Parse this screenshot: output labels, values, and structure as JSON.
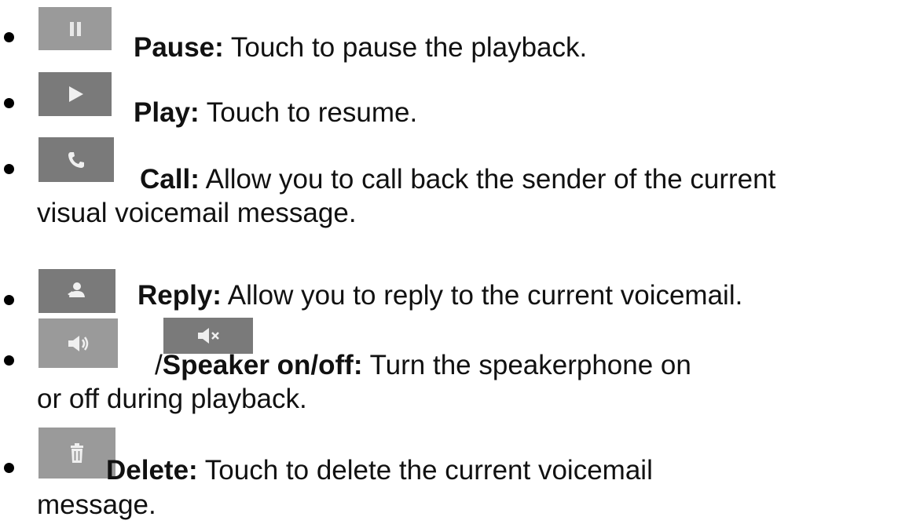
{
  "items": [
    {
      "icon": "pause-icon",
      "term": "Pause:",
      "text": " Touch to pause the playback.",
      "continuation": ""
    },
    {
      "icon": "play-icon",
      "term": "Play:",
      "text": " Touch to resume.",
      "continuation": ""
    },
    {
      "icon": "phone-icon",
      "term": "Call:",
      "text": " Allow you to call back the sender of the current",
      "continuation": "visual voicemail message."
    },
    {
      "icon": "reply-icon",
      "term": "Reply:",
      "text": " Allow you to reply to the current voicemail.",
      "continuation": ""
    },
    {
      "icon": "speaker-on-icon",
      "icon2": "speaker-off-icon",
      "prefix": "/",
      "term": "Speaker on/off:",
      "text": " Turn the speakerphone on",
      "continuation": "or off during playback."
    },
    {
      "icon": "trash-icon",
      "term": "Delete:",
      "text": " Touch to delete the current voicemail",
      "continuation": "message."
    }
  ]
}
